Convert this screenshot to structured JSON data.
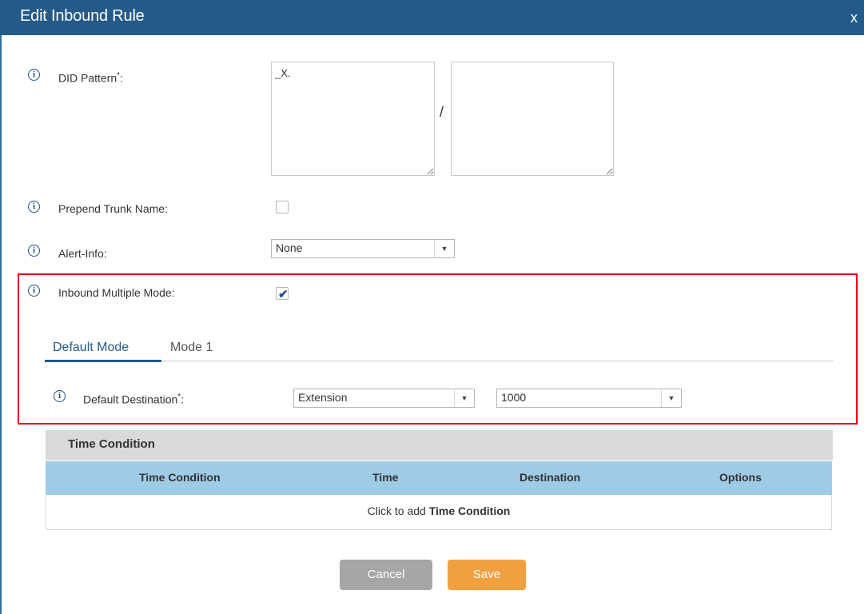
{
  "dialog": {
    "title": "Edit Inbound Rule",
    "close_label": "x"
  },
  "form": {
    "did_pattern": {
      "label": "DID Pattern",
      "required_mark": "*",
      "suffix": ":",
      "value": "_X.",
      "separator": "/",
      "value2": ""
    },
    "prepend_trunk_name": {
      "label": "Prepend Trunk Name:",
      "checked": false
    },
    "alert_info": {
      "label": "Alert-Info:",
      "selected": "None"
    },
    "inbound_multiple_mode": {
      "label": "Inbound Multiple Mode:",
      "checked": true
    }
  },
  "tabs": [
    {
      "label": "Default Mode",
      "active": true
    },
    {
      "label": "Mode 1",
      "active": false
    }
  ],
  "default_destination": {
    "label": "Default Destination",
    "required_mark": "*",
    "suffix": ":",
    "type_selected": "Extension",
    "target_selected": "1000"
  },
  "time_condition": {
    "header": "Time Condition",
    "columns": [
      "Time Condition",
      "Time",
      "Destination",
      "Options"
    ],
    "empty_prefix": "Click to add ",
    "empty_link": "Time Condition"
  },
  "buttons": {
    "cancel": "Cancel",
    "save": "Save"
  },
  "colors": {
    "title_bar": "#235a89",
    "highlight_box": "#e2001a",
    "table_header": "#9fcbe6",
    "save_button": "#f0a040",
    "cancel_button": "#a6a6a6"
  },
  "icons": {
    "info": "info-icon",
    "dropdown": "chevron-down-icon",
    "check": "checkmark-icon"
  }
}
